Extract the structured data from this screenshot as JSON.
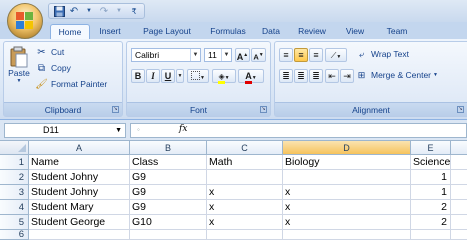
{
  "quick_access": {
    "save_icon": "save-icon",
    "undo_icon": "undo-icon",
    "redo_icon": "redo-icon",
    "customize_glyph": "₹"
  },
  "tabs": [
    {
      "label": "Home",
      "active": true
    },
    {
      "label": "Insert"
    },
    {
      "label": "Page Layout"
    },
    {
      "label": "Formulas"
    },
    {
      "label": "Data"
    },
    {
      "label": "Review"
    },
    {
      "label": "View"
    },
    {
      "label": "Team"
    }
  ],
  "clipboard": {
    "paste": "Paste",
    "cut": "Cut",
    "copy": "Copy",
    "format_painter": "Format Painter",
    "group_label": "Clipboard"
  },
  "font": {
    "name": "Calibri",
    "size": "11",
    "bold": "B",
    "italic": "I",
    "underline": "U",
    "grow": "A",
    "shrink": "A",
    "font_color_letter": "A",
    "group_label": "Font"
  },
  "alignment": {
    "wrap_text": "Wrap Text",
    "merge_center": "Merge & Center",
    "group_label": "Alignment"
  },
  "formula_bar": {
    "name_box": "D11",
    "fx": "fx",
    "formula": ""
  },
  "columns": [
    "A",
    "B",
    "C",
    "D",
    "E"
  ],
  "rows": [
    {
      "num": "1",
      "cells": [
        "Name",
        "Class",
        "Math",
        "Biology",
        "Science"
      ]
    },
    {
      "num": "2",
      "cells": [
        "Student Johny",
        "G9",
        "",
        "",
        "1"
      ]
    },
    {
      "num": "3",
      "cells": [
        "Student Johny",
        "G9",
        "x",
        "x",
        "1"
      ]
    },
    {
      "num": "4",
      "cells": [
        "Student Mary",
        "G9",
        "x",
        "x",
        "2"
      ]
    },
    {
      "num": "5",
      "cells": [
        "Student George",
        "G10",
        "x",
        "x",
        "2"
      ]
    },
    {
      "num": "6",
      "cells": [
        "",
        "",
        "",
        "",
        ""
      ]
    }
  ],
  "colors": {
    "ribbon_bg": "#dbe7f6",
    "tab_text": "#15428b",
    "header_bg": "#e4ecf7",
    "gridline": "#d0d7e5"
  }
}
